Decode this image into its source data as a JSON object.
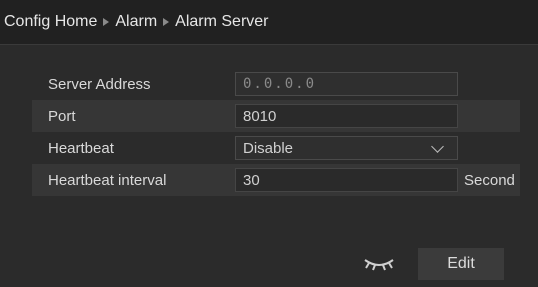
{
  "breadcrumb": {
    "items": [
      "Config Home",
      "Alarm",
      "Alarm Server"
    ]
  },
  "form": {
    "server_address": {
      "label": "Server Address",
      "placeholder": "0.0.0.0"
    },
    "port": {
      "label": "Port",
      "value": "8010"
    },
    "heartbeat": {
      "label": "Heartbeat",
      "value": "Disable"
    },
    "heartbeat_interval": {
      "label": "Heartbeat interval",
      "value": "30",
      "unit": "Second"
    }
  },
  "footer": {
    "edit_label": "Edit",
    "icon": "eye-closed-icon"
  },
  "colors": {
    "background": "#2b2b2b",
    "header": "#212121",
    "row_alt": "#363636"
  }
}
